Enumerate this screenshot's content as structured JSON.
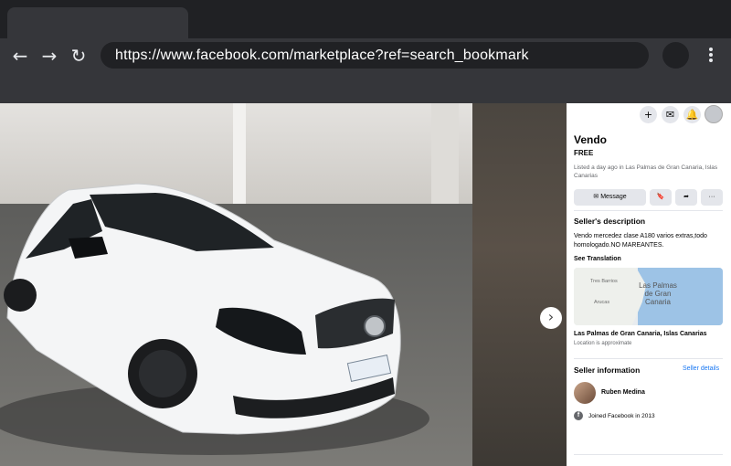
{
  "browser": {
    "url": "https://www.facebook.com/marketplace?ref=search_bookmark",
    "back_icon": "←",
    "forward_icon": "→",
    "reload_icon": "↻"
  },
  "viewer": {
    "next_icon": "›"
  },
  "panel": {
    "top_icons": {
      "create": "+",
      "messenger": "✉",
      "notifications": "🔔"
    },
    "listing": {
      "title": "Vendo",
      "price": "FREE",
      "listed": "Listed a day ago in Las Palmas de Gran Canaria, Islas Canarias"
    },
    "actions": {
      "message_label": "Message",
      "message_icon": "✉",
      "save_icon": "🔖",
      "share_icon": "➦",
      "more_icon": "···"
    },
    "description": {
      "heading": "Seller's description",
      "text": "Vendo mercedez clase A180 varios extras,todo homologado.NO MAREANTES.",
      "see_translation": "See Translation"
    },
    "map": {
      "labels": [
        "Tres Barrios",
        "Arucas"
      ],
      "city": "Las Palmas de Gran Canaria",
      "location_name": "Las Palmas de Gran Canaria, Islas Canarias",
      "approx": "Location is approximate"
    },
    "seller": {
      "heading": "Seller information",
      "details_link": "Seller details",
      "name": "Ruben Medina",
      "joined": "Joined Facebook in 2013"
    },
    "colors": {
      "accent": "#1877f2",
      "secondary_text": "#65676b"
    }
  }
}
